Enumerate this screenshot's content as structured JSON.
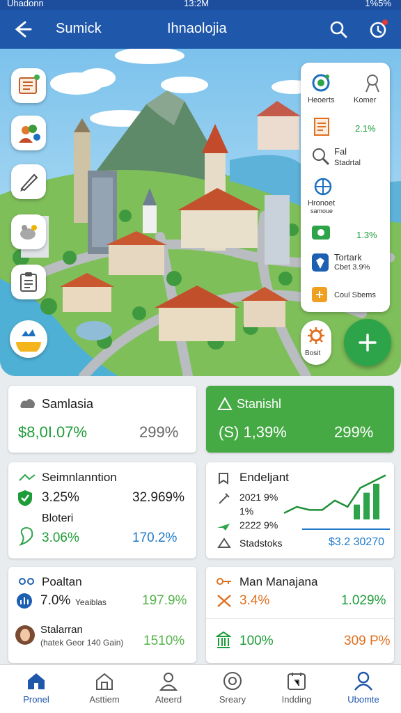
{
  "status_bar": {
    "carrier": "Uhadonn",
    "time": "13:2M",
    "battery": "1%5%"
  },
  "app_bar": {
    "subtitle": "Sumick",
    "title": "Ihnaolojia"
  },
  "right_panel": {
    "item1": "Heoerts",
    "item2": "Komer",
    "item3_value": "2.1%",
    "item4_label": "Fal",
    "item4_sub": "Stadrtal",
    "item5_label": "Hronoet",
    "item5_sub": "samoue",
    "item6_value": "1.3%",
    "item7_label": "Tortark",
    "item7_sub": "Cbet 3.9%",
    "item8_label": "Coul Sbems",
    "gear_label": "Bosit"
  },
  "cards": {
    "c1": {
      "title": "Samlasia",
      "value": "$8,0I.07%",
      "pct": "299%"
    },
    "c2": {
      "title": "Stanishl",
      "value": "(S) 1,39%",
      "pct": "299%"
    },
    "c3": {
      "title": "Seimnlanntion",
      "v1": "3.25%",
      "v2": "32.969%",
      "sub": "Bloteri",
      "v3": "3.06%",
      "v4": "170.2%"
    },
    "c4": {
      "title": "Endeljant",
      "l1": "2021 9%",
      "l2": "1%",
      "l3": "2222 9%",
      "l4": "Stadstoks",
      "total": "$3.2 30270"
    },
    "c5": {
      "title": "Poaltan",
      "v1": "7.0%",
      "v1_sub": "Yeaiblas",
      "v2": "197.9%",
      "person_name": "Stalarran",
      "person_sub": "(hatek Geor 140 Gain)",
      "v3": "1510%"
    },
    "c6": {
      "title": "Man Manajana",
      "v1": "3.4%",
      "v2": "1.029%",
      "v3": "100%",
      "v4": "309 P%"
    }
  },
  "nav": [
    {
      "label": "Pronel"
    },
    {
      "label": "Asttiem"
    },
    {
      "label": "Ateerd"
    },
    {
      "label": "Sreary"
    },
    {
      "label": "Indding"
    },
    {
      "label": "Ubomte"
    }
  ],
  "colors": {
    "header": "#1f57ab",
    "accent_green": "#2ea44a",
    "nav_active": "#1f57ab"
  },
  "chart_data": {
    "type": "line",
    "y": [
      2,
      4,
      3,
      3,
      6,
      4,
      10,
      12,
      14
    ],
    "bars": [
      5,
      9,
      12
    ]
  }
}
